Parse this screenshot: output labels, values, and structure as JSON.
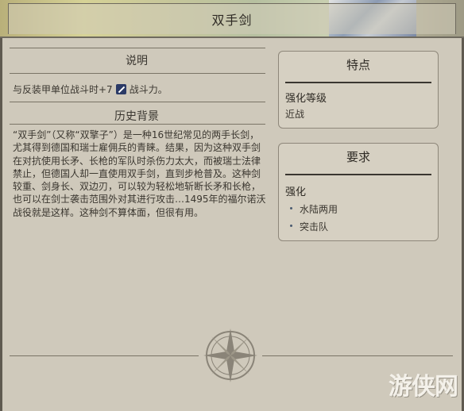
{
  "header": {
    "title": "双手剑"
  },
  "description": {
    "heading": "说明",
    "text_before": "与反装甲单位战斗时+7",
    "text_after": "战斗力。",
    "icon": "sword-strength-icon"
  },
  "history": {
    "heading": "历史背景",
    "text": "“双手剑”（又称“双擎子”）是一种16世纪常见的两手长剑，尤其得到德国和瑞士雇佣兵的青睐。结果，因为这种双手剑在对抗使用长矛、长枪的军队时杀伤力太大，而被瑞士法律禁止，但德国人却一直使用双手剑，直到步枪普及。这种剑较重、剑身长、双边刃，可以较为轻松地斩断长矛和长枪，也可以在剑士袭击范围外对其进行攻击…1495年的福尔诺沃战役就是这样。这种剑不算体面，但很有用。"
  },
  "features": {
    "heading": "特点",
    "label": "强化等级",
    "value": "近战"
  },
  "requirements": {
    "heading": "要求",
    "label": "强化",
    "items": [
      "水陆两用",
      "突击队"
    ]
  },
  "watermark": "游侠网",
  "colors": {
    "panel": "#cfc9bb",
    "card": "#d6d0c2",
    "text": "#3a3630",
    "bullet": "#4a5a70"
  }
}
